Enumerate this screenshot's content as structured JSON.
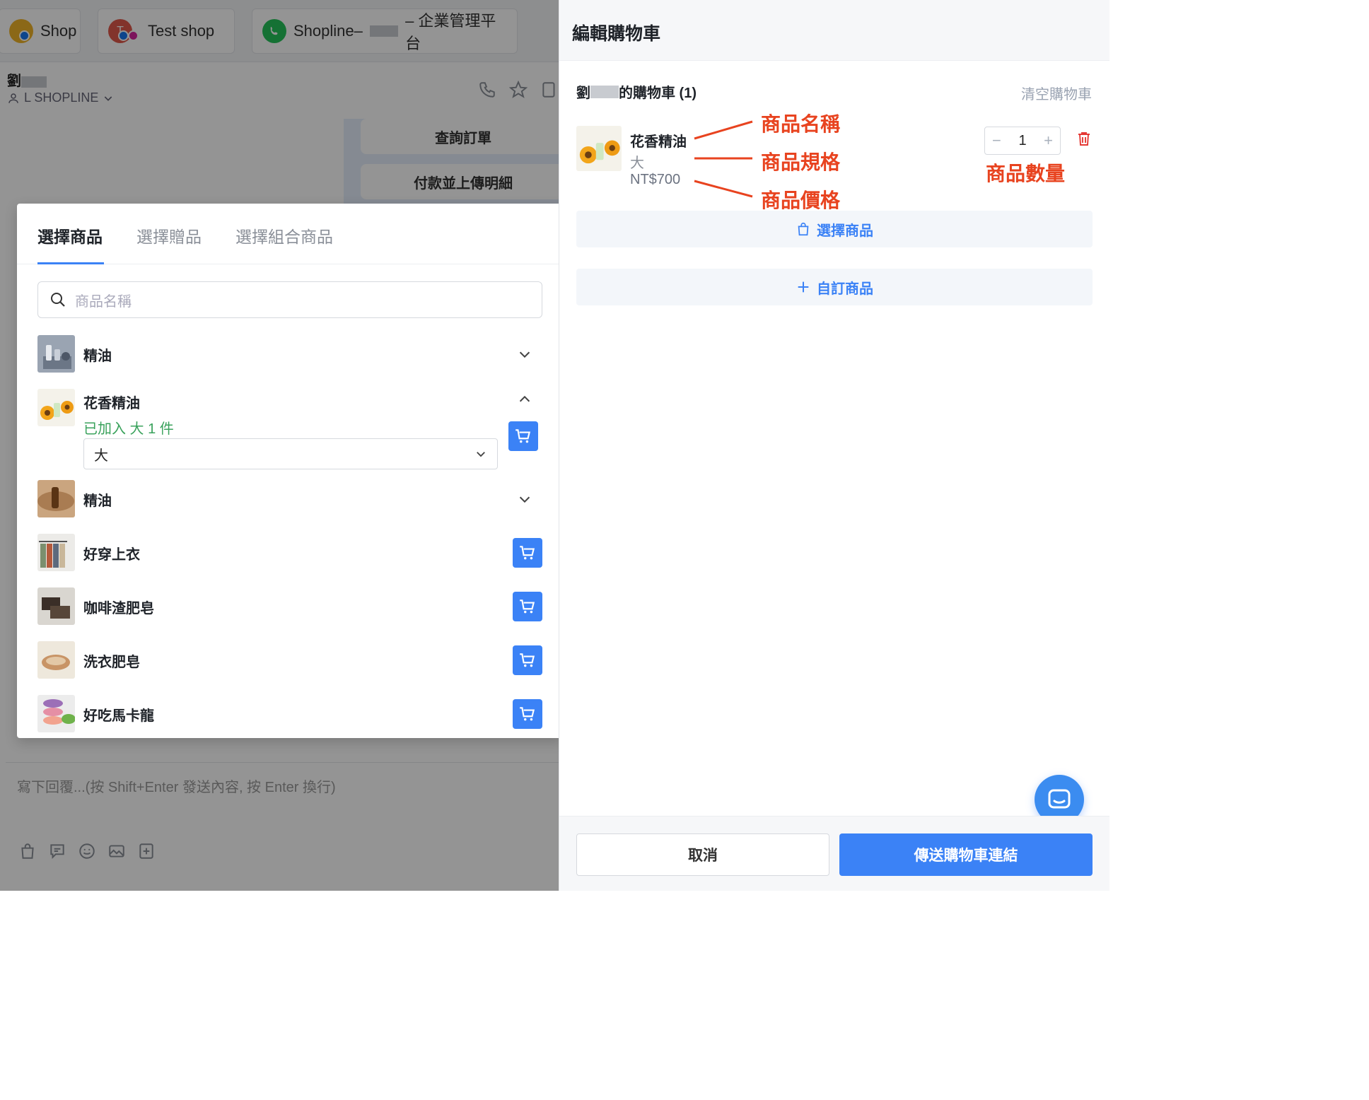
{
  "chat": {
    "tabs": [
      {
        "label": "Shop"
      },
      {
        "label": "Test shop",
        "avatar_letter": "T"
      },
      {
        "label_pre": "Shopline–",
        "label_post": "– 企業管理平台"
      }
    ],
    "customer_name": "劉",
    "agent": "L SHOPLINE",
    "quick_replies": [
      "查詢訂單",
      "付款並上傳明細"
    ],
    "composer_placeholder": "寫下回覆...(按 Shift+Enter 發送內容, 按 Enter 換行)"
  },
  "picker": {
    "tabs": [
      "選擇商品",
      "選擇贈品",
      "選擇組合商品"
    ],
    "search_placeholder": "商品名稱",
    "products": [
      {
        "name": "精油",
        "thumb": "oil-bottles",
        "control": "expand"
      },
      {
        "name": "花香精油",
        "thumb": "flower-oil",
        "control": "collapse",
        "added_note": "已加入 大 1 件",
        "spec_value": "大"
      },
      {
        "name": "精油",
        "thumb": "amber-bottle",
        "control": "expand"
      },
      {
        "name": "好穿上衣",
        "thumb": "clothes",
        "control": "cart"
      },
      {
        "name": "咖啡渣肥皂",
        "thumb": "soap-dark",
        "control": "cart"
      },
      {
        "name": "洗衣肥皂",
        "thumb": "soap-light",
        "control": "cart"
      },
      {
        "name": "好吃馬卡龍",
        "thumb": "macaron",
        "control": "cart"
      }
    ]
  },
  "panel": {
    "title": "編輯購物車",
    "cart_owner_pre": "劉",
    "cart_owner_post": "的購物車 (1)",
    "clear_label": "清空購物車",
    "item": {
      "name": "花香精油",
      "spec": "大",
      "price": "NT$700",
      "qty": "1"
    },
    "annotations": {
      "name": "商品名稱",
      "spec": "商品規格",
      "price": "商品價格",
      "qty": "商品數量"
    },
    "select_product_label": "選擇商品",
    "custom_product_label": "自訂商品",
    "cancel_label": "取消",
    "send_label": "傳送購物車連結"
  },
  "colors": {
    "accent": "#3b82f6",
    "annotation": "#e8431f",
    "added": "#3aa25c"
  }
}
